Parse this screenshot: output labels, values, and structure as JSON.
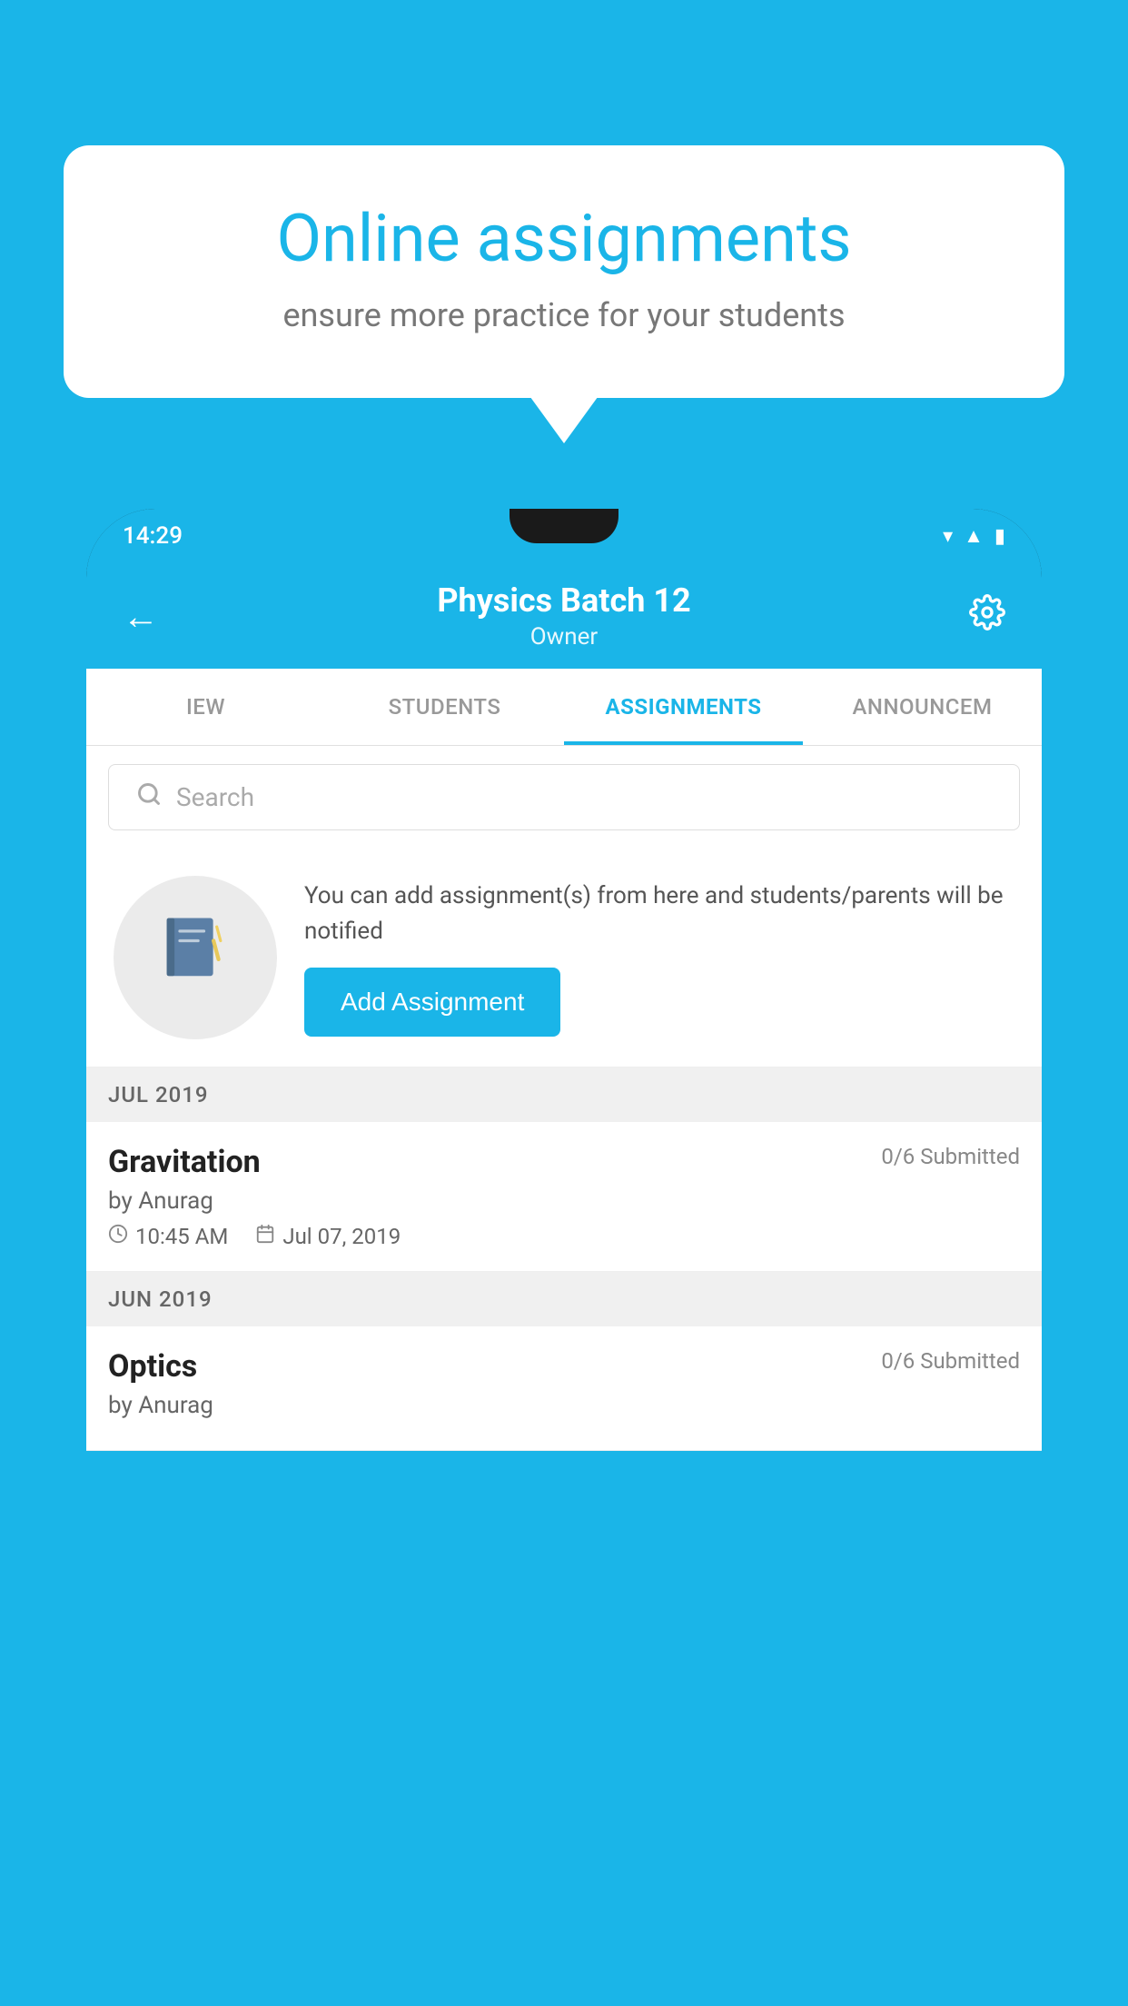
{
  "background": {
    "color": "#1ab5e8"
  },
  "bubble": {
    "title": "Online assignments",
    "subtitle": "ensure more practice for your students"
  },
  "phone": {
    "status_bar": {
      "time": "14:29"
    },
    "header": {
      "title": "Physics Batch 12",
      "subtitle": "Owner"
    },
    "tabs": [
      {
        "label": "IEW",
        "active": false
      },
      {
        "label": "STUDENTS",
        "active": false
      },
      {
        "label": "ASSIGNMENTS",
        "active": true
      },
      {
        "label": "ANNOUNCEM",
        "active": false
      }
    ],
    "search": {
      "placeholder": "Search"
    },
    "promo": {
      "description": "You can add assignment(s) from here and students/parents will be notified",
      "button_label": "Add Assignment"
    },
    "sections": [
      {
        "label": "JUL 2019",
        "assignments": [
          {
            "name": "Gravitation",
            "submitted": "0/6 Submitted",
            "by": "by Anurag",
            "time": "10:45 AM",
            "date": "Jul 07, 2019"
          }
        ]
      },
      {
        "label": "JUN 2019",
        "assignments": [
          {
            "name": "Optics",
            "submitted": "0/6 Submitted",
            "by": "by Anurag",
            "time": "",
            "date": ""
          }
        ]
      }
    ]
  }
}
